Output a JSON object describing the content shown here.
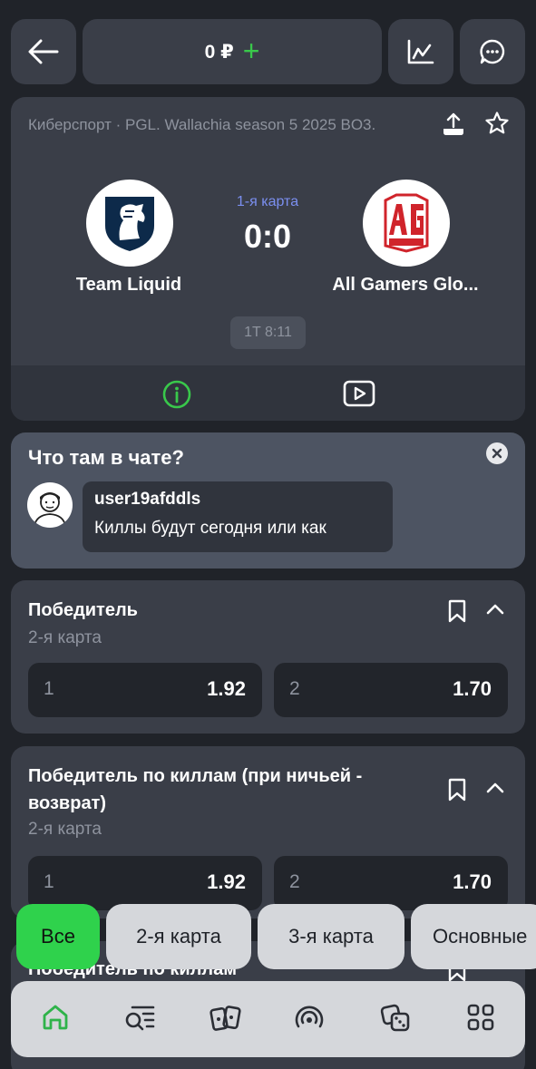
{
  "topbar": {
    "balance": "0 ₽",
    "balance_plus": "+"
  },
  "match": {
    "league": "Киберспорт · PGL. Wallachia season 5 2025 BO3.",
    "team1": "Team Liquid",
    "team2": "All Gamers Glo...",
    "map": "1-я карта",
    "score": "0:0",
    "time": "1T 8:11"
  },
  "chat": {
    "title": "Что там в чате?",
    "user": "user19afddls",
    "message": "Киллы будут сегодня или как"
  },
  "markets": [
    {
      "title": "Победитель",
      "subtitle": "2-я карта",
      "odds": [
        {
          "label": "1",
          "value": "1.92"
        },
        {
          "label": "2",
          "value": "1.70"
        }
      ]
    },
    {
      "title": "Победитель по киллам (при ничьей - возврат)",
      "subtitle": "2-я карта",
      "odds": [
        {
          "label": "1",
          "value": "1.92"
        },
        {
          "label": "2",
          "value": "1.70"
        }
      ]
    },
    {
      "title": "Победитель по киллам"
    }
  ],
  "filters": [
    "Все",
    "2-я карта",
    "3-я карта",
    "Основные"
  ],
  "icons": {
    "back": "arrow-left-icon",
    "stats": "line-chart-icon",
    "chat": "chat-bubble-icon",
    "share": "share-icon",
    "favorite": "star-icon",
    "info": "info-icon",
    "video": "play-video-icon",
    "close": "close-icon",
    "bookmark": "bookmark-icon",
    "collapse": "chevron-up-icon",
    "nav": [
      "home-icon",
      "search-list-icon",
      "cards-icon",
      "live-broadcast-icon",
      "dice-icon",
      "grid-icon"
    ]
  },
  "colors": {
    "background": "#202329",
    "card": "#3a3e48",
    "accent_green": "#2fd24c",
    "map_label_blue": "#7b8ff0",
    "odd_button": "#22252b",
    "muted_text": "#8e939e"
  }
}
